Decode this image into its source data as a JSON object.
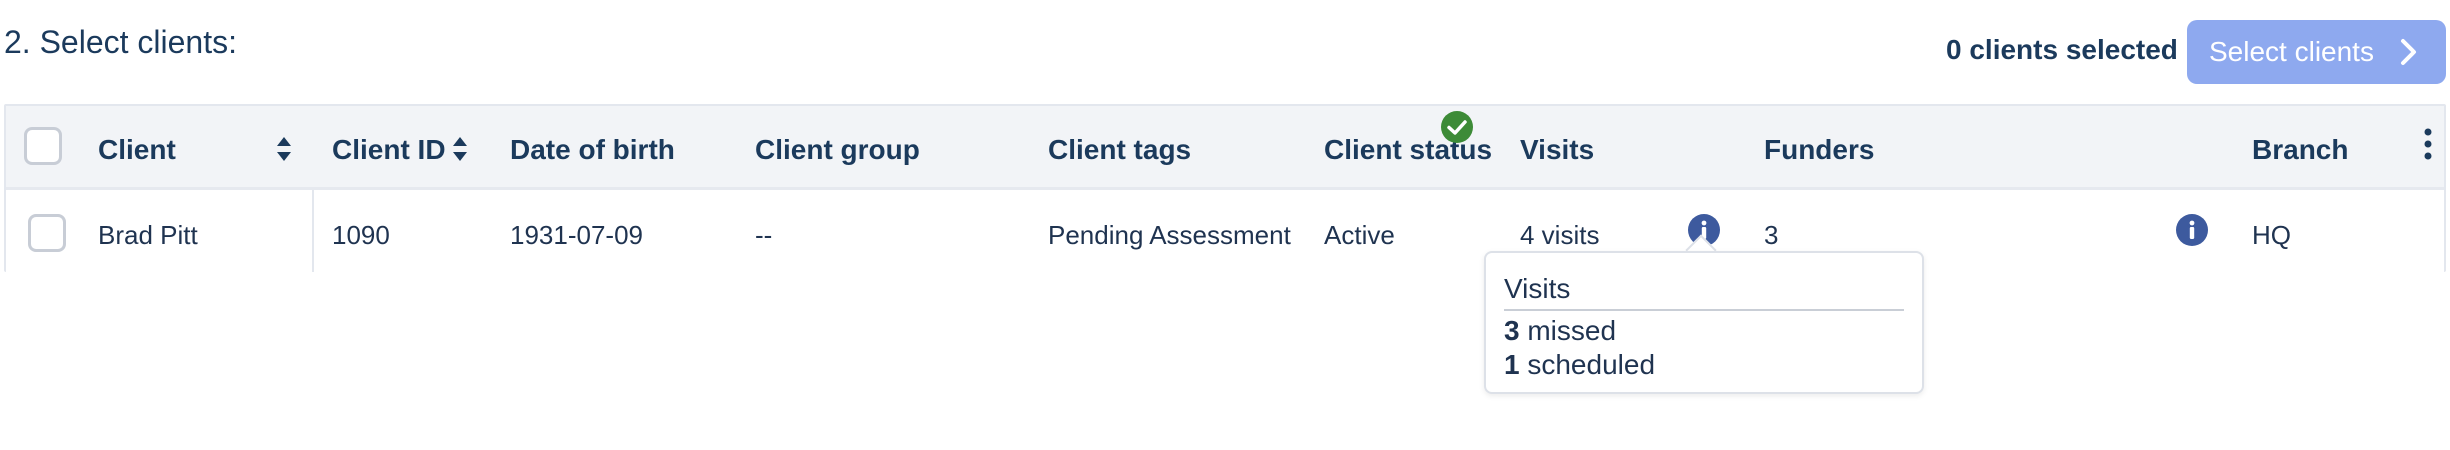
{
  "header": {
    "section_title": "2. Select clients:",
    "selected_count": "0 clients selected",
    "select_button_label": "Select clients"
  },
  "table": {
    "columns": {
      "client": "Client",
      "client_id": "Client ID",
      "date_of_birth": "Date of birth",
      "client_group": "Client group",
      "client_tags": "Client tags",
      "client_status": "Client status",
      "visits": "Visits",
      "funders": "Funders",
      "branch": "Branch"
    },
    "rows": [
      {
        "client": "Brad Pitt",
        "client_id": "1090",
        "date_of_birth": "1931-07-09",
        "client_group": "--",
        "client_tags": "Pending Assessment",
        "client_status": "Active",
        "visits": "4 visits",
        "funders": "3",
        "branch": "HQ"
      }
    ]
  },
  "tooltip": {
    "title": "Visits",
    "missed_count": "3",
    "missed_label": "missed",
    "scheduled_count": "1",
    "scheduled_label": "scheduled"
  },
  "colors": {
    "primary_text": "#1b3a5c",
    "button_disabled": "#8ea9ef",
    "status_active": "#3d8b37",
    "info_icon": "#3d5a9e",
    "header_bg": "#f2f4f7"
  },
  "icons": {
    "sort": "sort-icon",
    "chevron": "chevron-right-icon",
    "status": "check-circle-icon",
    "info": "info-icon",
    "menu": "kebab-menu-icon"
  }
}
